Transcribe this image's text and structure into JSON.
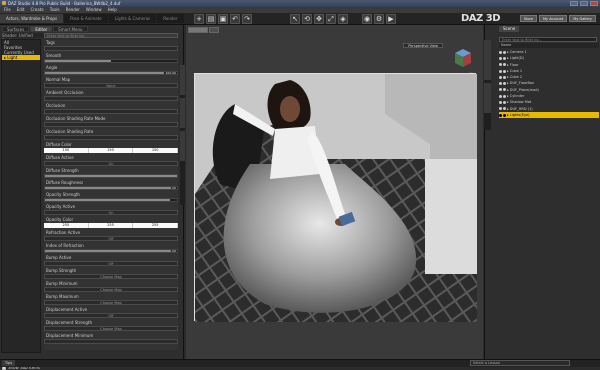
{
  "window": {
    "title": "DAZ Studio 4.8 Pro Public Build - Ballerina_BW4b2_4.duf"
  },
  "menu": [
    "File",
    "Edit",
    "Create",
    "Tools",
    "Render",
    "Window",
    "Help"
  ],
  "activity_tabs": [
    "Actors, Wardrobe & Props",
    "Pose & Animate",
    "Lights & Cameras",
    "Render"
  ],
  "brand": "DAZ 3D",
  "top_buttons": [
    "Store",
    "My Account",
    "My Gallery"
  ],
  "left_panel": {
    "tabs": [
      "Surfaces",
      "Editor",
      "Smart Menu"
    ],
    "tree_label": "Shader: Unified Surface",
    "tree": [
      "All",
      "Favorites",
      "Currently Used",
      "Light"
    ],
    "tree_selected": "Light",
    "properties": [
      {
        "label": "Tags",
        "kind": "map"
      },
      {
        "label": "Smooth",
        "kind": "slider",
        "level": 0.5
      },
      {
        "label": "Angle",
        "kind": "slider",
        "level": 0.9,
        "value": "100.00"
      },
      {
        "label": "Normal Map",
        "kind": "map",
        "map": "None"
      },
      {
        "label": "Ambient Occlusion",
        "kind": "map"
      },
      {
        "label": "Occlusion",
        "kind": "map"
      },
      {
        "label": "Occlusion Shading Rate Mode",
        "kind": "map"
      },
      {
        "label": "Occlusion Shading Rate",
        "kind": "map"
      },
      {
        "label": "Diffuse Color",
        "kind": "rgb",
        "rgb": [
          "150",
          "150",
          "150"
        ]
      },
      {
        "label": "Diffuse Active",
        "kind": "map",
        "map": "On"
      },
      {
        "label": "Diffuse Strength",
        "kind": "slider",
        "level": 1.0
      },
      {
        "label": "Diffuse Roughness",
        "kind": "slider",
        "level": 0.95,
        "value": "1.00"
      },
      {
        "label": "Opacity Strength",
        "kind": "slider",
        "level": 0.95
      },
      {
        "label": "Opacity Active",
        "kind": "map",
        "map": "On"
      },
      {
        "label": "Opacity Color",
        "kind": "rgb",
        "rgb": [
          "255",
          "255",
          "255"
        ]
      },
      {
        "label": "Refraction Active",
        "kind": "map",
        "map": "Off"
      },
      {
        "label": "Index of Refraction",
        "kind": "slider",
        "level": 0.95,
        "value": "1.00"
      },
      {
        "label": "Bump Active",
        "kind": "map",
        "map": "Off"
      },
      {
        "label": "Bump Strength",
        "kind": "map",
        "map": "Choose Map"
      },
      {
        "label": "Bump Minimum",
        "kind": "map",
        "map": "Choose Map"
      },
      {
        "label": "Bump Maximum",
        "kind": "map",
        "map": "Choose Map"
      },
      {
        "label": "Displacement Active",
        "kind": "map",
        "map": "Off"
      },
      {
        "label": "Displacement Strength",
        "kind": "map",
        "map": "Choose Map"
      },
      {
        "label": "Displacement Minimum",
        "kind": "map"
      }
    ],
    "show_sub_items": "Show Sub Items"
  },
  "viewport": {
    "camera_label": "Perspective View",
    "tab_label": "Viewport"
  },
  "right_panel": {
    "tabs": [
      "Scene"
    ],
    "search_placeholder": "Enter text to filter by...",
    "tree_header": "Name",
    "nodes": [
      "Camera 1",
      "Light(D)",
      "Floor",
      "Cube 1",
      "Cube 2",
      "DUF_FloorBox",
      "DUF_Plane(mod)",
      "Cylinder",
      "Shadow Mat",
      "DUF_HRD (1)",
      "Lights(Eye)"
    ],
    "selected": "Lights(Eye)"
  },
  "status": {
    "tips": "Tips",
    "select": "Select a Lesson"
  }
}
